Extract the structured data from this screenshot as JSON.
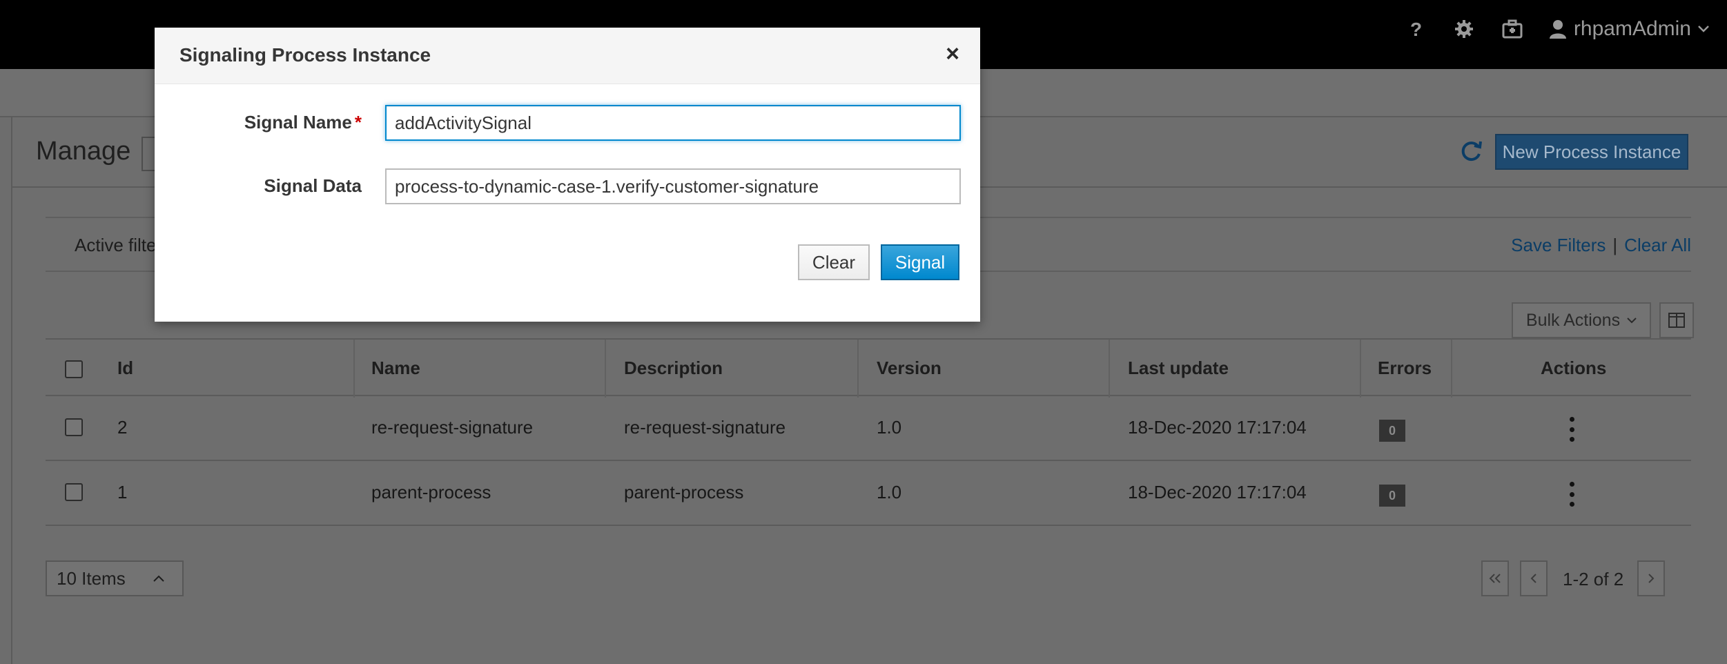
{
  "masthead": {
    "help_icon": "help-icon",
    "settings_icon": "gear-icon",
    "tasks_icon": "briefcase-icon",
    "user_name": "rhpamAdmin"
  },
  "page": {
    "title": "Manage",
    "new_instance_label": "New Process Instance",
    "filters": {
      "active_label": "Active filte",
      "save_label": "Save Filters",
      "separator": "|",
      "clear_all_label": "Clear All"
    },
    "bulk_actions_label": "Bulk Actions",
    "table": {
      "headers": [
        "Id",
        "Name",
        "Description",
        "Version",
        "Last update",
        "Errors",
        "Actions"
      ],
      "rows": [
        {
          "id": "2",
          "name": "re-request-signature",
          "description": "re-request-signature",
          "version": "1.0",
          "last_update": "18-Dec-2020 17:17:04",
          "errors": "0"
        },
        {
          "id": "1",
          "name": "parent-process",
          "description": "parent-process",
          "version": "1.0",
          "last_update": "18-Dec-2020 17:17:04",
          "errors": "0"
        }
      ]
    },
    "pagination": {
      "items_per_page": "10 Items",
      "range_label": "1-2 of 2"
    }
  },
  "modal": {
    "title": "Signaling Process Instance",
    "close_glyph": "×",
    "signal_name": {
      "label": "Signal Name",
      "required_mark": "*",
      "value": "addActivitySignal"
    },
    "signal_data": {
      "label": "Signal Data",
      "value": "process-to-dynamic-case-1.verify-customer-signature"
    },
    "clear_label": "Clear",
    "signal_label": "Signal"
  },
  "colors": {
    "masthead_bg": "#000000",
    "overlay_gray": "#6e6e6e",
    "primary_blue": "#0088ce",
    "link_blue_dimmed": "#0b3d66",
    "required_red": "#cc0000"
  }
}
